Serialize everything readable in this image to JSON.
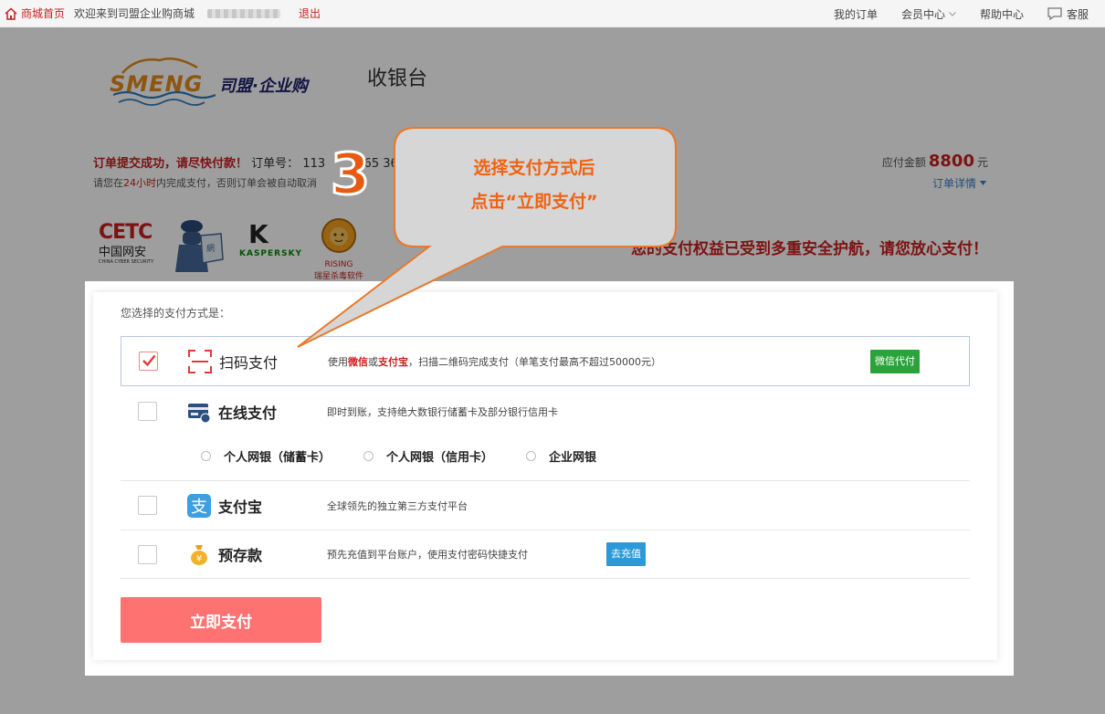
{
  "topbar": {
    "home_label": "商城首页",
    "welcome": "欢迎来到司盟企业购商城",
    "logout": "退出",
    "my_orders": "我的订单",
    "member_center": "会员中心",
    "help_center": "帮助中心",
    "customer_service": "客服"
  },
  "header": {
    "logo_text": "SMENG",
    "logo_cn": "司盟·企业购",
    "page_title": "收银台"
  },
  "order": {
    "success_msg": "订单提交成功，请尽快付款！",
    "order_no_label": "订单号：",
    "order_no": "113",
    "order_no_tail": "465",
    "order_no_end": "36394",
    "hint_before": "请您在",
    "hint_highlight": "24小时",
    "hint_after": "内完成支付，否则订单会被自动取消",
    "amount_label": "应付金额",
    "amount_value": "8800",
    "amount_unit": "元",
    "detail_link": "订单详情"
  },
  "security": {
    "cetc_big": "CETC",
    "cetc_cn": "中国网安",
    "cetc_en": "CHINA CYBER SECURITY",
    "kaspersky": "KASPERSKY",
    "rising_en": "RISING",
    "rising_cn": "瑞星杀毒软件",
    "message": "您的支付权益已受到多重安全护航，请您放心支付！"
  },
  "payment": {
    "title": "您选择的支付方式是：",
    "scan": {
      "name": "扫码支付",
      "desc_prefix": "使用",
      "wechat": "微信",
      "or": "或",
      "alipay": "支付宝",
      "desc_suffix": "，扫描二维码完成支付（单笔支付最高不超过50000元）",
      "badge": "微信代付",
      "checked": true
    },
    "online": {
      "name": "在线支付",
      "desc": "即时到账，支持绝大数银行储蓄卡及部分银行信用卡",
      "options": [
        "个人网银（储蓄卡）",
        "个人网银（信用卡）",
        "企业网银"
      ]
    },
    "alipay": {
      "name": "支付宝",
      "desc": "全球领先的独立第三方支付平台"
    },
    "deposit": {
      "name": "预存款",
      "desc": "预先充值到平台账户，使用支付密码快捷支付",
      "badge": "去充值"
    },
    "submit": "立即支付"
  },
  "callout": {
    "step": "3",
    "line1": "选择支付方式后",
    "line2": "点击“立即支付”"
  },
  "colors": {
    "brand_red": "#c91f1f",
    "callout_orange": "#ee6213",
    "pay_button": "#ff7272",
    "wechat_green": "#2aa43a",
    "recharge_blue": "#2c9ad9"
  }
}
